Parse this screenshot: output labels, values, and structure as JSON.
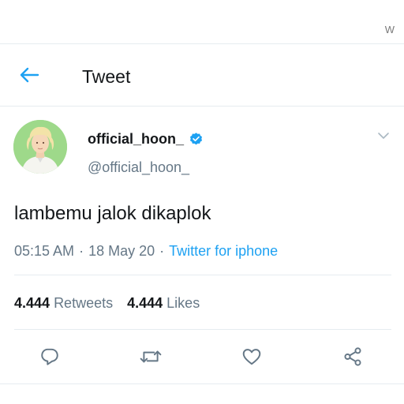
{
  "status_bar": {
    "letter": "W"
  },
  "header": {
    "title": "Tweet"
  },
  "tweet": {
    "display_name": "official_hoon_",
    "handle": "@official_hoon_",
    "text": "lambemu jalok dikaplok",
    "time": "05:15 AM",
    "separator": "·",
    "date": "18 May 20",
    "source": "Twitter for iphone"
  },
  "stats": {
    "retweets_count": "4.444",
    "retweets_label": "Retweets",
    "likes_count": "4.444",
    "likes_label": "Likes"
  },
  "colors": {
    "accent": "#1da1f2",
    "secondary_text": "#657786",
    "avatar_bg": "#9ed98a"
  },
  "icons": {
    "back": "arrow-left-icon",
    "verified": "verified-badge-icon",
    "more": "chevron-down-icon",
    "reply": "reply-icon",
    "retweet": "retweet-icon",
    "like": "heart-icon",
    "share": "share-icon"
  }
}
